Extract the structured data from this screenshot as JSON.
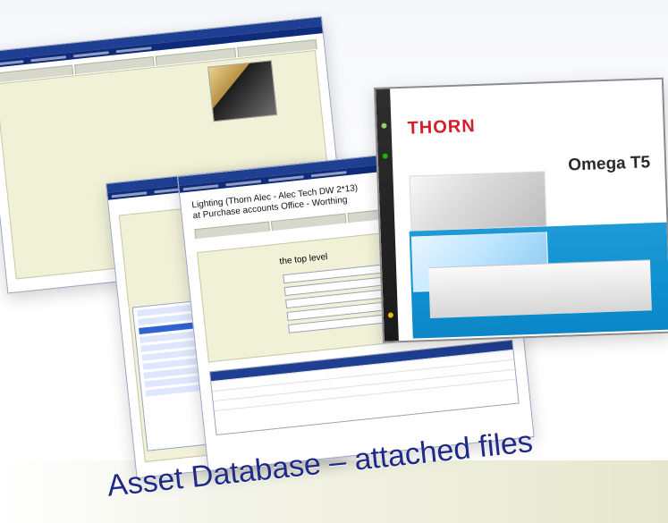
{
  "caption": "Asset Database – attached files",
  "windows": {
    "front": {
      "title": "Lighting (Thorn Alec - Alec Tech DW 2*13)",
      "subtitle": "at Purchase accounts Office - Worthing",
      "tree_label": "the top level"
    },
    "thorn": {
      "logo": "THORN",
      "product": "Omega T5"
    }
  },
  "colors": {
    "caption": "#1f2a88",
    "thorn_red": "#d21f2b",
    "thorn_blue": "#0f8fd1",
    "window_blue": "#1f3f93"
  }
}
